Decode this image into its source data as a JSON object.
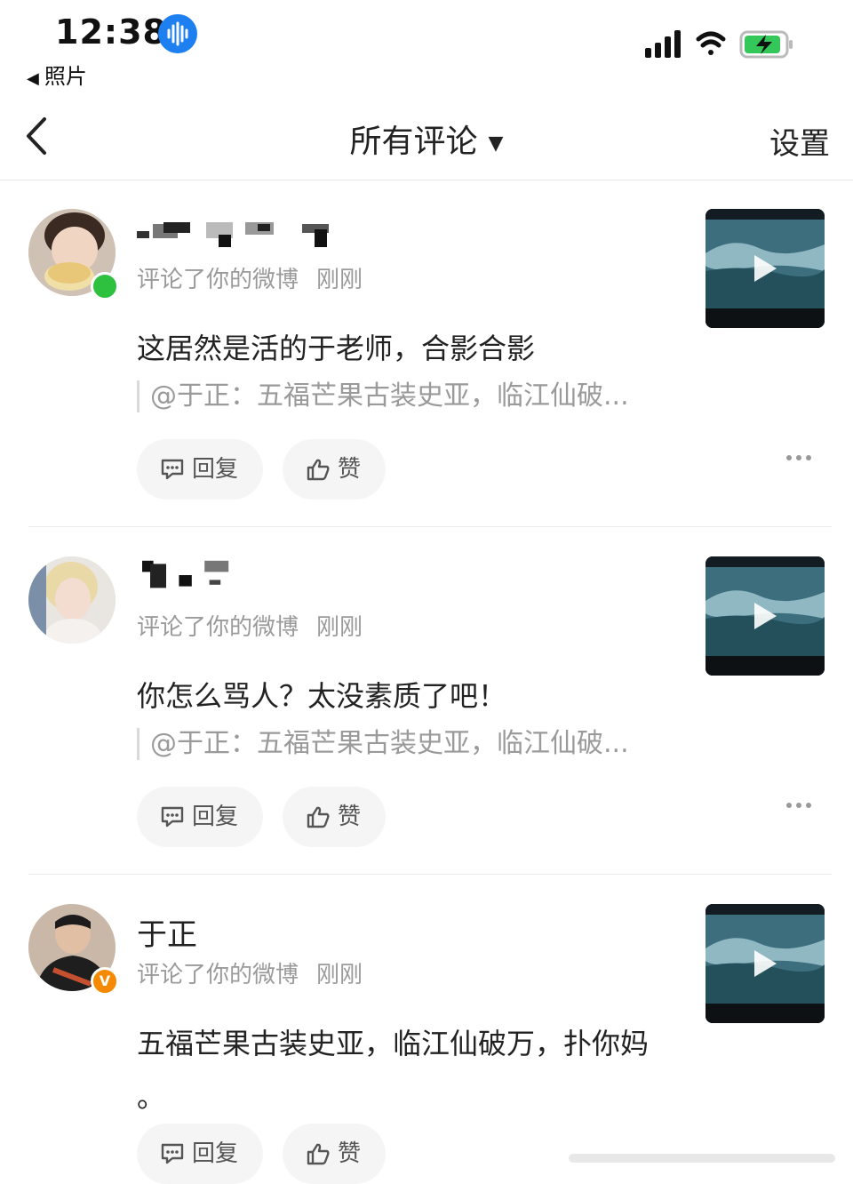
{
  "status_bar": {
    "time": "12:38",
    "back_app": "照片",
    "icons": [
      "siri-waveform-icon",
      "cellular-signal-icon",
      "wifi-icon",
      "battery-charging-icon"
    ]
  },
  "nav": {
    "title": "所有评论",
    "settings": "设置",
    "back_icon": "chevron-left-icon",
    "caret_icon": "caret-down-icon"
  },
  "colors": {
    "online": "#2ec13f",
    "verified": "#f58a00",
    "meta_text": "#9a9a9a",
    "pill_bg": "#f5f5f5"
  },
  "comments": [
    {
      "username": "",
      "username_obscured": true,
      "meta": "评论了你的微博",
      "time_ago": "刚刚",
      "text": "这居然是活的于老师，合影合影",
      "quote": "@于正：五福芒果古装史亚，临江仙破...",
      "reply_label": "回复",
      "like_label": "赞",
      "badge": "online"
    },
    {
      "username": "",
      "username_obscured": true,
      "meta": "评论了你的微博",
      "time_ago": "刚刚",
      "text": "你怎么骂人？太没素质了吧！",
      "quote": "@于正：五福芒果古装史亚，临江仙破...",
      "reply_label": "回复",
      "like_label": "赞",
      "badge": "none"
    },
    {
      "username": "于正",
      "username_obscured": false,
      "meta": "评论了你的微博",
      "time_ago": "刚刚",
      "text": "五福芒果古装史亚，临江仙破万，扑你妈",
      "text_line2": "。",
      "reply_label": "回复",
      "like_label": "赞",
      "badge": "verified",
      "badge_text": "V"
    }
  ]
}
